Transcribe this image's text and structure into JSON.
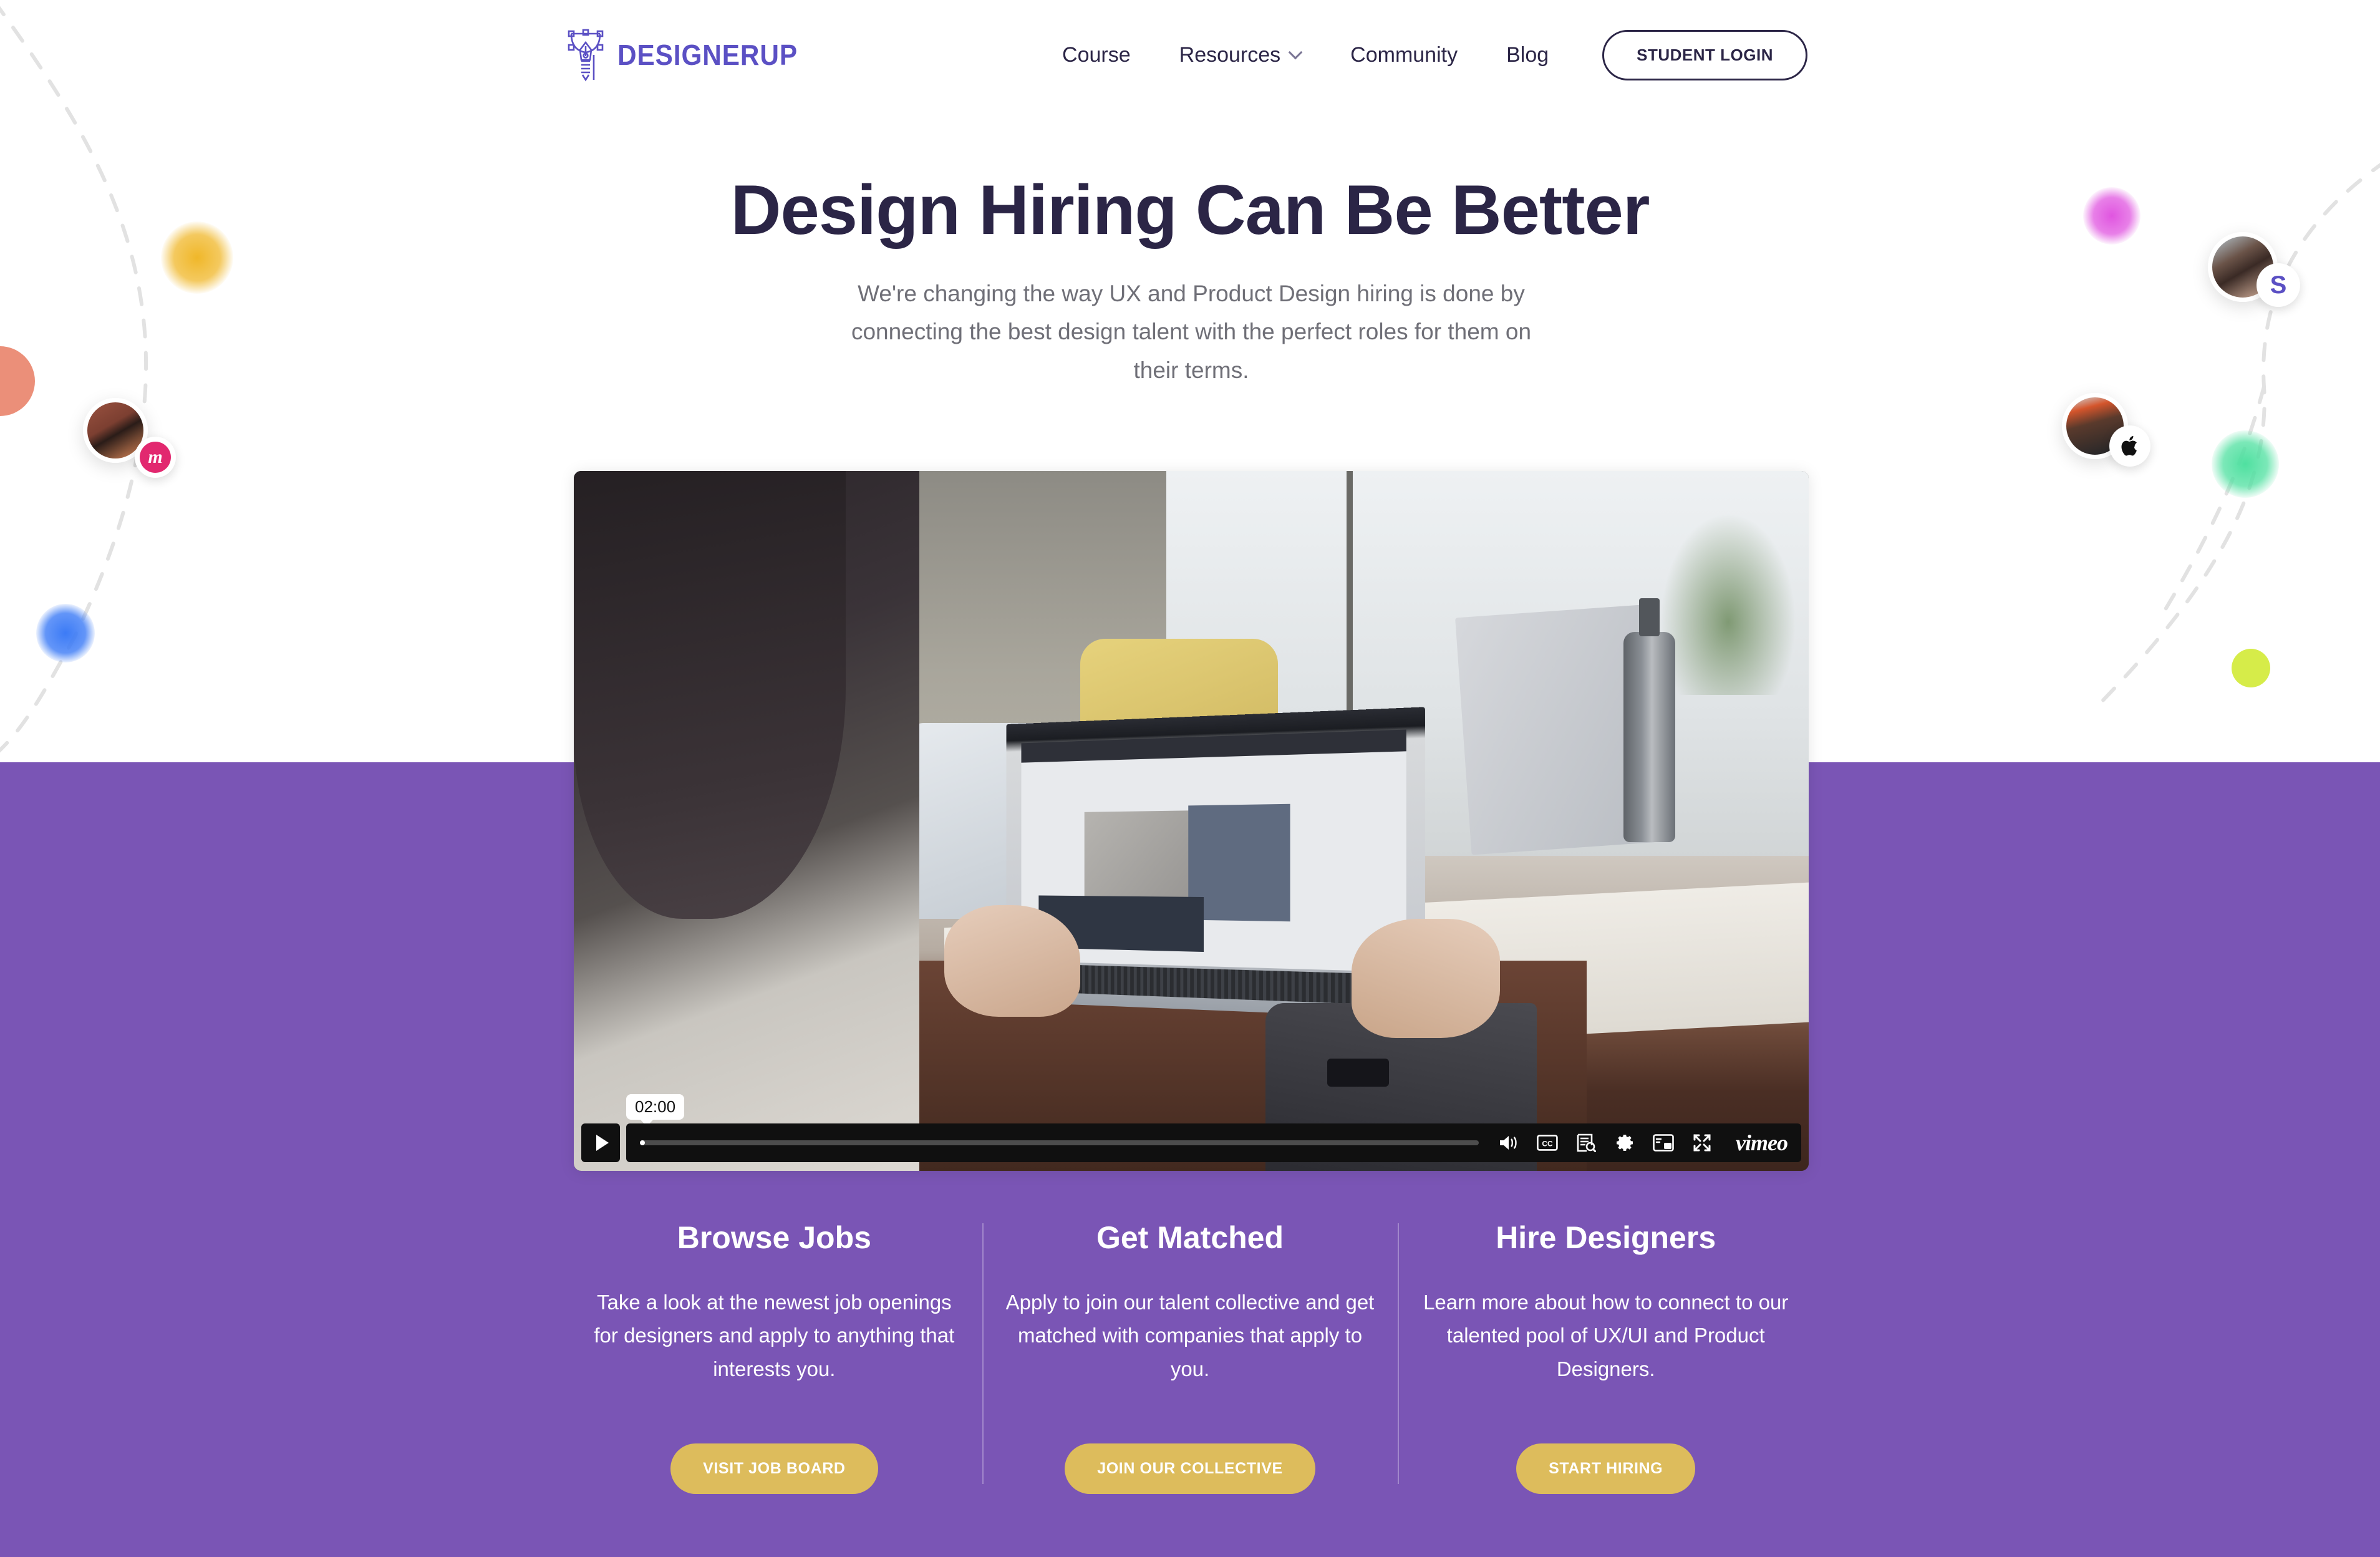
{
  "brand": {
    "logo_text": "DESIGNERUP",
    "logo_icon": "pen-nib-icon",
    "purple": "#7a55b5",
    "logo_purple": "#5b50c4",
    "gold": "#ddbc5c",
    "ink": "#2b2546"
  },
  "nav": {
    "links": [
      {
        "label": "Course",
        "has_dropdown": false
      },
      {
        "label": "Resources",
        "has_dropdown": true
      },
      {
        "label": "Community",
        "has_dropdown": false
      },
      {
        "label": "Blog",
        "has_dropdown": false
      }
    ],
    "login_label": "STUDENT LOGIN"
  },
  "hero": {
    "title": "Design Hiring Can Be Better",
    "subtitle": "We're changing the way UX and Product Design hiring is done by connecting the best design talent with the perfect roles for them on their terms."
  },
  "video": {
    "provider": "vimeo",
    "provider_label": "vimeo",
    "tooltip_time": "02:00",
    "play_label": "Play",
    "controls": [
      {
        "name": "volume-icon",
        "label": "Volume"
      },
      {
        "name": "closed-captions-icon",
        "label": "CC"
      },
      {
        "name": "transcript-search-icon",
        "label": "Transcript"
      },
      {
        "name": "settings-gear-icon",
        "label": "Settings"
      },
      {
        "name": "picture-in-picture-icon",
        "label": "Picture in Picture"
      },
      {
        "name": "fullscreen-icon",
        "label": "Fullscreen"
      }
    ]
  },
  "features": [
    {
      "title": "Browse Jobs",
      "desc": "Take a look at the newest job openings for designers and apply to anything that interests you.",
      "button": "VISIT JOB BOARD"
    },
    {
      "title": "Get Matched",
      "desc": "Apply to join our talent collective and get matched with companies that apply to you.",
      "button": "JOIN OUR COLLECTIVE"
    },
    {
      "title": "Hire Designers",
      "desc": "Learn more about how to connect to our talented pool of UX/UI and Product Designers.",
      "button": "START HIRING"
    }
  ],
  "decorations": {
    "avatars": [
      {
        "name": "avatar-designer-left",
        "badge": "medium-logo-badge",
        "badge_glyph": "m",
        "badge_color": "#e2286f"
      },
      {
        "name": "avatar-designer-top-right",
        "badge": "slack-logo-badge",
        "badge_glyph": "S",
        "badge_color": "#5b50c4"
      },
      {
        "name": "avatar-designer-right",
        "badge": "apple-logo-badge",
        "badge_glyph": "",
        "badge_color": "#111111"
      }
    ],
    "dots": [
      {
        "name": "dot-yellow",
        "color": "#f0b729"
      },
      {
        "name": "dot-coral",
        "color": "#eb8f79"
      },
      {
        "name": "dot-blue",
        "color": "#3c7bf6"
      },
      {
        "name": "dot-magenta",
        "color": "#e055e0"
      },
      {
        "name": "dot-green",
        "color": "#4fe0a0"
      },
      {
        "name": "dot-lime",
        "color": "#d6ec49"
      }
    ]
  }
}
